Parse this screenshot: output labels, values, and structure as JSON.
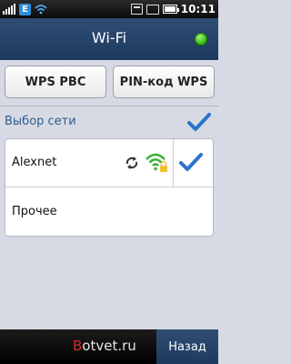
{
  "status_bar": {
    "time": "10:11",
    "network_badge": "E",
    "icons": [
      "signal-icon",
      "network-e-icon",
      "wifi-icon",
      "box-icon",
      "message-icon",
      "battery-icon"
    ]
  },
  "header": {
    "title": "Wi-Fi",
    "status_color": "#29b400"
  },
  "buttons": {
    "wps_pbc": "WPS PBC",
    "pin_wps": "PIN-код WPS"
  },
  "section": {
    "label": "Выбор сети",
    "checked": true
  },
  "networks": [
    {
      "name": "Alexnet",
      "icons": [
        "refresh-icon",
        "wifi-secured-icon"
      ],
      "checked": true
    },
    {
      "name": "Прочее"
    }
  ],
  "bottom": {
    "watermark": "Botvet.ru",
    "watermark_first": "B",
    "watermark_rest": "otvet.ru",
    "back_label": "Назад"
  },
  "colors": {
    "accent": "#2e5c93",
    "check": "#2b74c9",
    "wifi_green": "#3db13b",
    "lock_yellow": "#f2c12e"
  }
}
